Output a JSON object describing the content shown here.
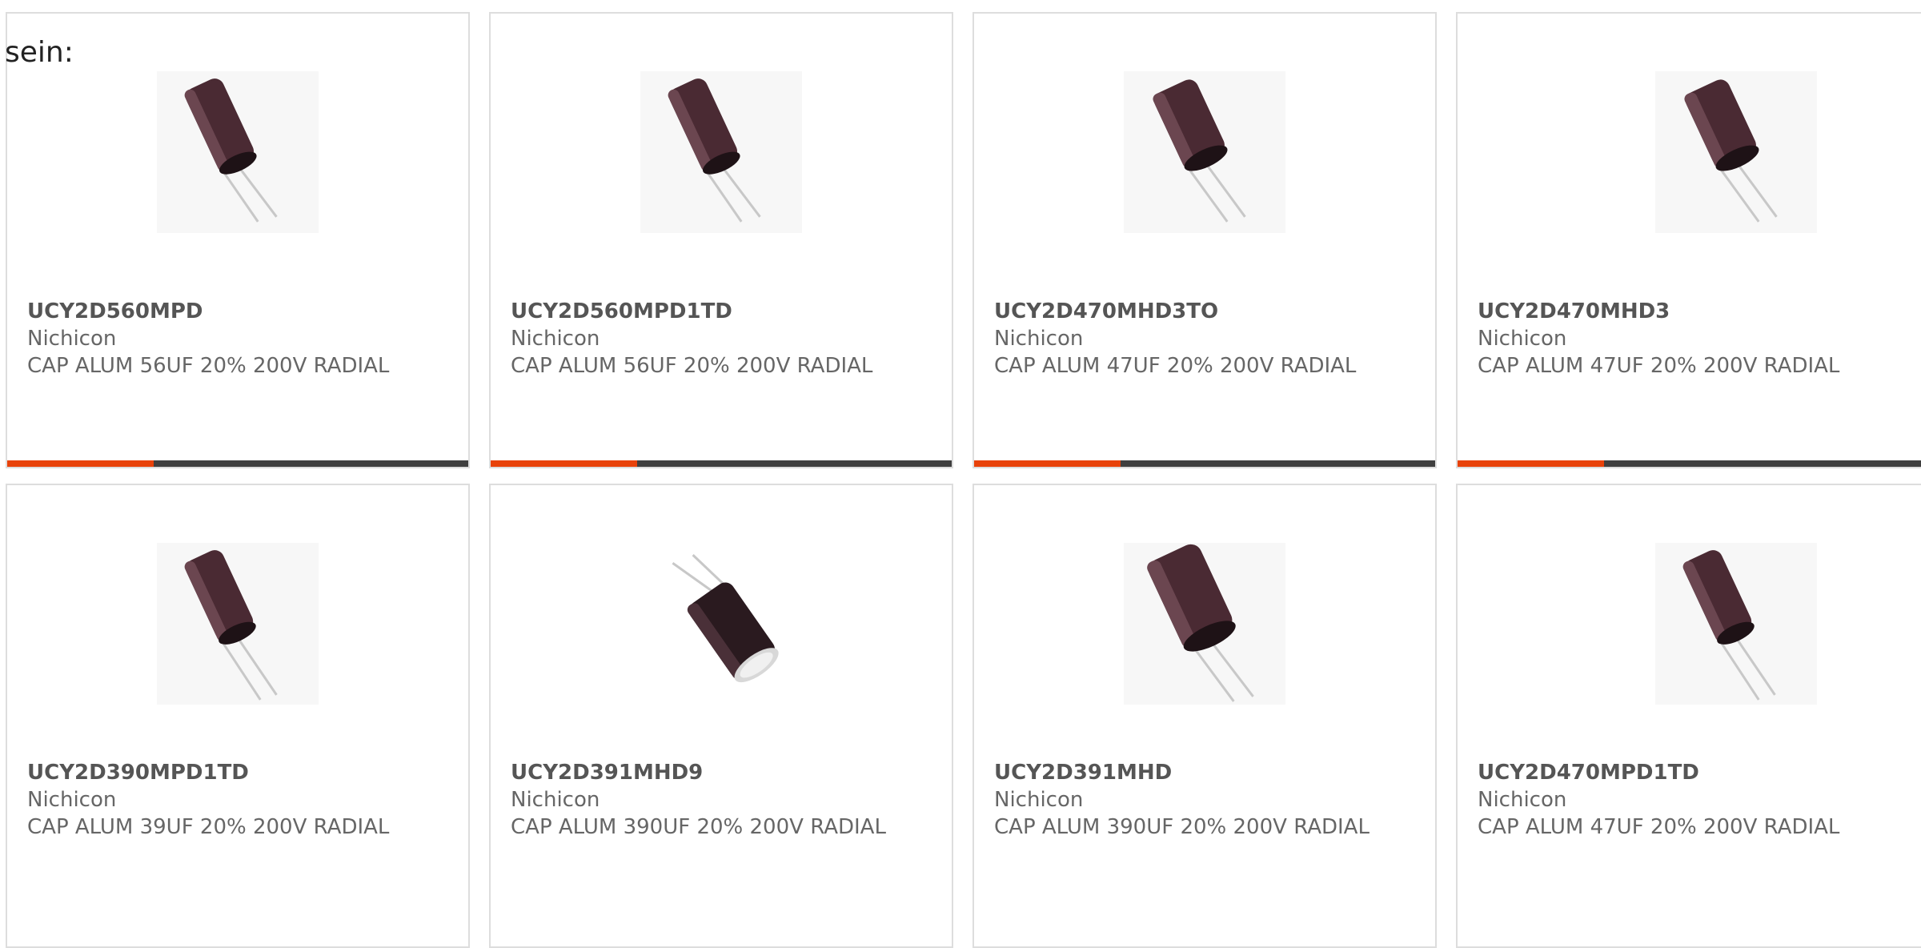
{
  "intro_text": "sein:",
  "colors": {
    "accent": "#e8420a",
    "bar_dark": "#3f3f3f",
    "capacitor_body": "#4a2a33"
  },
  "products": [
    {
      "part": "UCY2D560MPD",
      "manufacturer": "Nichicon",
      "description": "CAP ALUM 56UF 20% 200V RADIAL",
      "icon": "capacitor-image"
    },
    {
      "part": "UCY2D560MPD1TD",
      "manufacturer": "Nichicon",
      "description": "CAP ALUM 56UF 20% 200V RADIAL",
      "icon": "capacitor-image"
    },
    {
      "part": "UCY2D470MHD3TO",
      "manufacturer": "Nichicon",
      "description": "CAP ALUM 47UF 20% 200V RADIAL",
      "icon": "capacitor-image"
    },
    {
      "part": "UCY2D470MHD3",
      "manufacturer": "Nichicon",
      "description": "CAP ALUM 47UF 20% 200V RADIAL",
      "icon": "capacitor-image"
    },
    {
      "part": "UCY2D390MPD1TD",
      "manufacturer": "Nichicon",
      "description": "CAP ALUM 39UF 20% 200V RADIAL",
      "icon": "capacitor-image"
    },
    {
      "part": "UCY2D391MHD9",
      "manufacturer": "Nichicon",
      "description": "CAP ALUM 390UF 20% 200V RADIAL",
      "icon": "capacitor-image"
    },
    {
      "part": "UCY2D391MHD",
      "manufacturer": "Nichicon",
      "description": "CAP ALUM 390UF 20% 200V RADIAL",
      "icon": "capacitor-image"
    },
    {
      "part": "UCY2D470MPD1TD",
      "manufacturer": "Nichicon",
      "description": "CAP ALUM 47UF 20% 200V RADIAL",
      "icon": "capacitor-image"
    }
  ]
}
